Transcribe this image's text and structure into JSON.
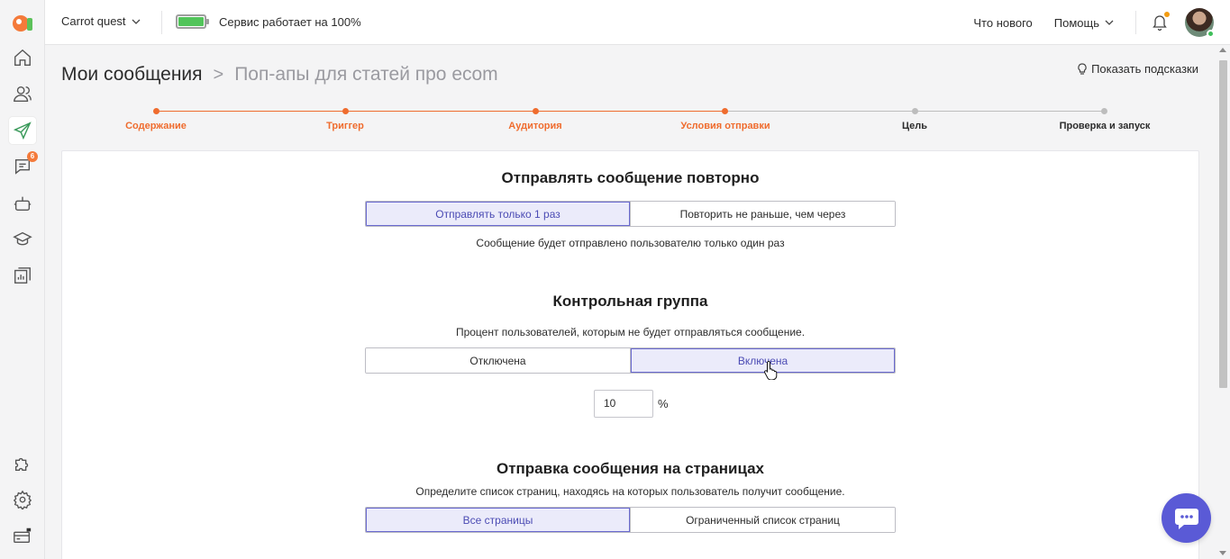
{
  "topbar": {
    "project_name": "Carrot quest",
    "service_status": "Сервис работает на 100%",
    "whats_new": "Что нового",
    "help": "Помощь"
  },
  "sidebar": {
    "items": [
      {
        "icon": "home-icon"
      },
      {
        "icon": "users-icon"
      },
      {
        "icon": "paper-plane-icon",
        "active": true
      },
      {
        "icon": "chat-icon",
        "badge": "6"
      },
      {
        "icon": "bot-icon"
      },
      {
        "icon": "graduation-cap-icon"
      },
      {
        "icon": "reports-icon"
      },
      {
        "icon": "puzzle-icon"
      },
      {
        "icon": "gear-icon"
      },
      {
        "icon": "billing-icon"
      }
    ],
    "chat_badge": "6"
  },
  "page": {
    "breadcrumb_root": "Мои сообщения",
    "breadcrumb_separator": ">",
    "breadcrumb_current": "Поп-апы для статей про ecom",
    "show_hints": "Показать подсказки"
  },
  "stepper": {
    "steps": [
      {
        "label": "Содержание",
        "done": true
      },
      {
        "label": "Триггер",
        "done": true
      },
      {
        "label": "Аудитория",
        "done": true
      },
      {
        "label": "Условия отправки",
        "done": true
      },
      {
        "label": "Цель",
        "done": false
      },
      {
        "label": "Проверка и запуск",
        "done": false
      }
    ]
  },
  "resend": {
    "title": "Отправлять сообщение повторно",
    "option_once": "Отправлять только 1 раз",
    "option_repeat": "Повторить не раньше, чем через",
    "selected": "once",
    "description": "Сообщение будет отправлено пользователю только один раз"
  },
  "control_group": {
    "title": "Контрольная группа",
    "description": "Процент пользователей, которым не будет отправляться сообщение.",
    "option_off": "Отключена",
    "option_on": "Включена",
    "selected": "on",
    "percent_value": "10",
    "percent_sign": "%"
  },
  "pages": {
    "title": "Отправка сообщения на страницах",
    "description": "Определите список страниц, находясь на которых пользователь получит сообщение.",
    "option_all": "Все страницы",
    "option_limited": "Ограниченный список страниц",
    "selected": "all"
  },
  "colors": {
    "accent": "#ef6c2e",
    "primary": "#5a5ad6",
    "selected_bg": "#ebebfa"
  }
}
